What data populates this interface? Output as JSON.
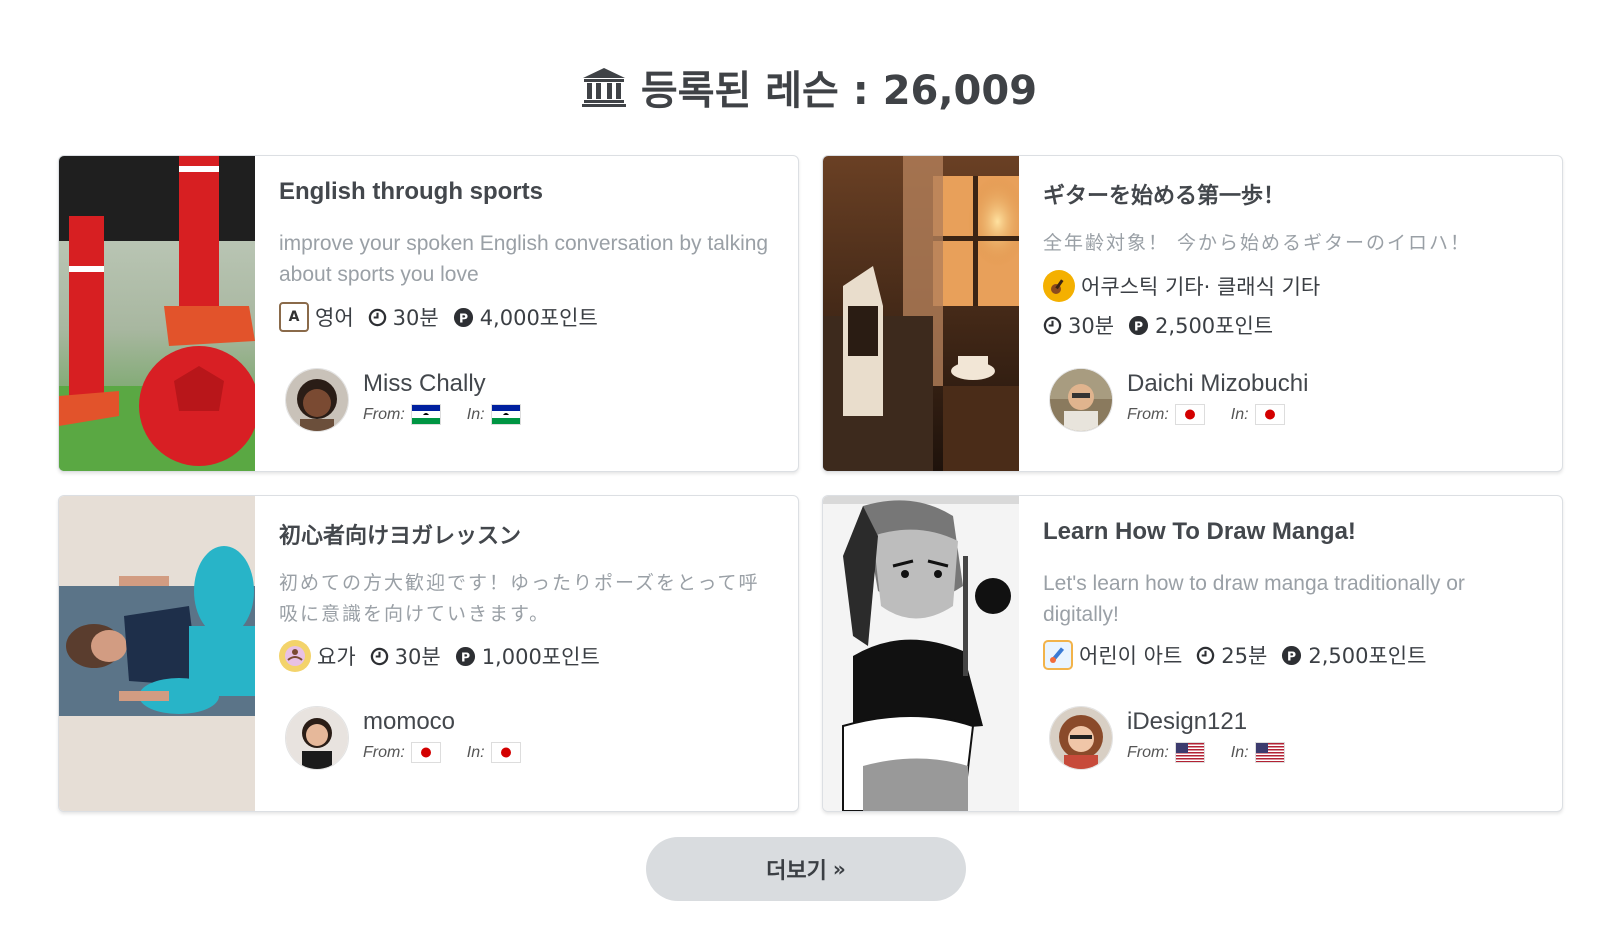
{
  "header": {
    "icon": "bank-icon",
    "title": "등록된 레슨 : 26,009"
  },
  "lessons": [
    {
      "title": "English through sports",
      "description": "improve your spoken English conversation by talking about sports you love",
      "category": "영어",
      "category_icon": "english-book-icon",
      "duration": "30분",
      "points": "4,000포인트",
      "teacher": "Miss Chally",
      "from_label": "From:",
      "in_label": "In:",
      "from_flag": "lesotho-flag",
      "in_flag": "lesotho-flag"
    },
    {
      "title": "ギターを始める第一歩！",
      "description": "全年齢対象！ 今から始めるギターのイロハ！",
      "category": "어쿠스틱 기타· 클래식 기타",
      "category_icon": "guitar-icon",
      "duration": "30분",
      "points": "2,500포인트",
      "teacher": "Daichi Mizobuchi",
      "from_label": "From:",
      "in_label": "In:",
      "from_flag": "japan-flag",
      "in_flag": "japan-flag"
    },
    {
      "title": "初心者向けヨガレッスン",
      "description": "初めての方大歓迎です！ゆったりポーズをとって呼吸に意識を向けていきます。",
      "category": "요가",
      "category_icon": "yoga-icon",
      "duration": "30분",
      "points": "1,000포인트",
      "teacher": "momoco",
      "from_label": "From:",
      "in_label": "In:",
      "from_flag": "japan-flag",
      "in_flag": "japan-flag"
    },
    {
      "title": "Learn How To Draw Manga!",
      "description": "Let's learn how to draw manga traditionally or digitally!",
      "category": "어린이 아트",
      "category_icon": "kids-art-icon",
      "duration": "25분",
      "points": "2,500포인트",
      "teacher": "iDesign121",
      "from_label": "From:",
      "in_label": "In:",
      "from_flag": "usa-flag",
      "in_flag": "usa-flag"
    }
  ],
  "more_button": {
    "label": "더보기",
    "arrow": "»"
  }
}
